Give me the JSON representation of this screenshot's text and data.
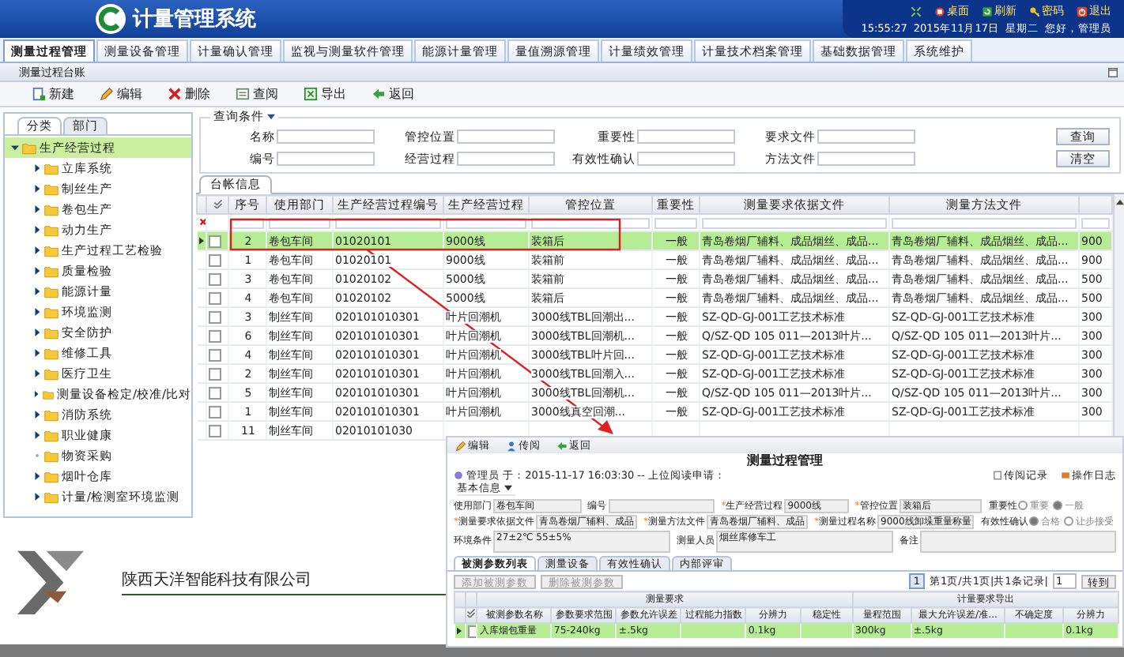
{
  "header": {
    "title": "计量管理系统",
    "links": [
      {
        "label": "桌面",
        "kind": "desktop"
      },
      {
        "label": "刷新",
        "kind": "refresh"
      },
      {
        "label": "密码",
        "kind": "key"
      },
      {
        "label": "退出",
        "kind": "exit"
      }
    ],
    "status": [
      "15:55:27",
      "2015年11月17日",
      "星期二",
      "您好，管理员"
    ]
  },
  "menu": [
    {
      "label": "测量过程管理",
      "selected": true
    },
    {
      "label": "测量设备管理",
      "selected": false
    },
    {
      "label": "计量确认管理",
      "selected": false
    },
    {
      "label": "监视与测量软件管理",
      "selected": false
    },
    {
      "label": "能源计量管理",
      "selected": false
    },
    {
      "label": "量值溯源管理",
      "selected": false
    },
    {
      "label": "计量绩效管理",
      "selected": false
    },
    {
      "label": "计量技术档案管理",
      "selected": false
    },
    {
      "label": "基础数据管理",
      "selected": false
    },
    {
      "label": "系统维护",
      "selected": false
    }
  ],
  "panel": {
    "title": "测量过程台账"
  },
  "toolbar": [
    {
      "label": "新建",
      "kind": "new"
    },
    {
      "label": "编辑",
      "kind": "edit"
    },
    {
      "label": "删除",
      "kind": "delete"
    },
    {
      "label": "查阅",
      "kind": "view"
    },
    {
      "label": "导出",
      "kind": "export"
    },
    {
      "label": "返回",
      "kind": "back"
    }
  ],
  "sidebar": {
    "tabs": [
      {
        "label": "分类",
        "selected": true
      },
      {
        "label": "部门",
        "selected": false
      }
    ],
    "tree": {
      "label": "生产经营过程",
      "has_children": true,
      "expanded": true,
      "selected": true,
      "children": [
        {
          "label": "立库系统",
          "has_children": true,
          "expanded": false,
          "selected": false
        },
        {
          "label": "制丝生产",
          "has_children": true,
          "expanded": false,
          "selected": false
        },
        {
          "label": "卷包生产",
          "has_children": true,
          "expanded": false,
          "selected": false
        },
        {
          "label": "动力生产",
          "has_children": true,
          "expanded": false,
          "selected": false
        },
        {
          "label": "生产过程工艺检验",
          "has_children": true,
          "expanded": false,
          "selected": false
        },
        {
          "label": "质量检验",
          "has_children": true,
          "expanded": false,
          "selected": false
        },
        {
          "label": "能源计量",
          "has_children": true,
          "expanded": false,
          "selected": false
        },
        {
          "label": "环境监测",
          "has_children": true,
          "expanded": false,
          "selected": false
        },
        {
          "label": "安全防护",
          "has_children": true,
          "expanded": false,
          "selected": false
        },
        {
          "label": "维修工具",
          "has_children": true,
          "expanded": false,
          "selected": false
        },
        {
          "label": "医疗卫生",
          "has_children": true,
          "expanded": false,
          "selected": false
        },
        {
          "label": "测量设备检定/校准/比对",
          "has_children": true,
          "expanded": false,
          "selected": false
        },
        {
          "label": "消防系统",
          "has_children": true,
          "expanded": false,
          "selected": false
        },
        {
          "label": "职业健康",
          "has_children": true,
          "expanded": false,
          "selected": false
        },
        {
          "label": "物资采购",
          "has_children": false,
          "selected": false
        },
        {
          "label": "烟叶仓库",
          "has_children": true,
          "expanded": false,
          "selected": false
        },
        {
          "label": "计量/检测室环境监测",
          "has_children": true,
          "expanded": false,
          "selected": false
        }
      ]
    }
  },
  "query": {
    "legend": "查询条件",
    "fields": [
      {
        "label": "名称"
      },
      {
        "label": "管控位置"
      },
      {
        "label": "重要性"
      },
      {
        "label": "要求文件"
      },
      {
        "label": "编号"
      },
      {
        "label": "经营过程"
      },
      {
        "label": "有效性确认"
      },
      {
        "label": "方法文件"
      }
    ],
    "buttons": [
      "查询",
      "清空"
    ]
  },
  "table": {
    "tab": "台帐信息",
    "columns": [
      "序号",
      "使用部门",
      "生产经营过程编号",
      "生产经营过程",
      "管控位置",
      "重要性",
      "测量要求依据文件",
      "测量方法文件"
    ],
    "rows": [
      {
        "selected": true,
        "checked": false,
        "cells": [
          "2",
          "卷包车间",
          "01020101",
          "9000线",
          "装箱后",
          "一般",
          "青岛卷烟厂辅料、成品烟丝、成品...",
          "青岛卷烟厂辅料、成品烟丝、成品...",
          "900"
        ]
      },
      {
        "selected": false,
        "checked": false,
        "cells": [
          "1",
          "卷包车间",
          "01020101",
          "9000线",
          "装箱前",
          "一般",
          "青岛卷烟厂辅料、成品烟丝、成品...",
          "青岛卷烟厂辅料、成品烟丝、成品...",
          "900"
        ]
      },
      {
        "selected": false,
        "checked": false,
        "cells": [
          "3",
          "卷包车间",
          "01020102",
          "5000线",
          "装箱前",
          "一般",
          "青岛卷烟厂辅料、成品烟丝、成品...",
          "青岛卷烟厂辅料、成品烟丝、成品...",
          "500"
        ]
      },
      {
        "selected": false,
        "checked": false,
        "cells": [
          "4",
          "卷包车间",
          "01020102",
          "5000线",
          "装箱后",
          "一般",
          "青岛卷烟厂辅料、成品烟丝、成品...",
          "青岛卷烟厂辅料、成品烟丝、成品...",
          "500"
        ]
      },
      {
        "selected": false,
        "checked": false,
        "cells": [
          "3",
          "制丝车间",
          "020101010301",
          "叶片回潮机",
          "3000线TBL回潮出...",
          "一般",
          "SZ-QD-GJ-001工艺技术标准",
          "SZ-QD-GJ-001工艺技术标准",
          "300"
        ]
      },
      {
        "selected": false,
        "checked": false,
        "cells": [
          "6",
          "制丝车间",
          "020101010301",
          "叶片回潮机",
          "3000线TBL回潮机...",
          "一般",
          "Q/SZ-QD 105 011—2013叶片...",
          "Q/SZ-QD 105 011—2013叶片...",
          "300"
        ]
      },
      {
        "selected": false,
        "checked": false,
        "cells": [
          "4",
          "制丝车间",
          "020101010301",
          "叶片回潮机",
          "3000线TBL叶片回...",
          "一般",
          "SZ-QD-GJ-001工艺技术标准",
          "SZ-QD-GJ-001工艺技术标准",
          "300"
        ]
      },
      {
        "selected": false,
        "checked": false,
        "cells": [
          "2",
          "制丝车间",
          "020101010301",
          "叶片回潮机",
          "3000线TBL回潮入...",
          "一般",
          "SZ-QD-GJ-001工艺技术标准",
          "SZ-QD-GJ-001工艺技术标准",
          "300"
        ]
      },
      {
        "selected": false,
        "checked": false,
        "cells": [
          "5",
          "制丝车间",
          "020101010301",
          "叶片回潮机",
          "3000线TBL回潮机...",
          "一般",
          "Q/SZ-QD 105 011—2013叶片...",
          "Q/SZ-QD 105 011—2013叶片...",
          "300"
        ]
      },
      {
        "selected": false,
        "checked": false,
        "cells": [
          "1",
          "制丝车间",
          "020101010301",
          "叶片回潮机",
          "3000线真空回潮...",
          "一般",
          "SZ-QD-GJ-001工艺技术标准",
          "SZ-QD-GJ-001工艺技术标准",
          "300"
        ]
      },
      {
        "selected": false,
        "checked": false,
        "cells": [
          "11",
          "制丝车间",
          "02010101030"
        ]
      }
    ]
  },
  "detail_window": {
    "toolbar": [
      {
        "label": "编辑",
        "kind": "edit"
      },
      {
        "label": "传阅",
        "kind": "share"
      },
      {
        "label": "返回",
        "kind": "back"
      }
    ],
    "title": "测量过程管理",
    "meta": "管理员 于：2015-11-17 16:03:30 -- 上位阅读申请：",
    "links": [
      {
        "label": "传阅记录",
        "kind": "doc"
      },
      {
        "label": "操作日志",
        "kind": "log"
      }
    ],
    "section": "基本信息",
    "field_rows": [
      [
        {
          "label": "使用部门",
          "value": "卷包车间",
          "kind": "text"
        },
        {
          "label": "编号",
          "kind": "text"
        },
        {
          "label": "生产经营过程",
          "value": "9000线",
          "kind": "text",
          "required_mark": "*"
        },
        {
          "label": "管控位置",
          "value": "装箱后",
          "kind": "text",
          "required_mark": "*"
        },
        {
          "label": "重要性",
          "kind": "radio",
          "options": [
            {
              "label": "重要",
              "selected": false
            },
            {
              "label": "一般",
              "selected": true
            }
          ]
        }
      ],
      [
        {
          "label": "测量要求依据文件",
          "value": "青岛卷烟厂辅料、成品",
          "kind": "text",
          "required_mark": "*"
        },
        {
          "label": "测量方法文件",
          "value": "青岛卷烟厂辅料、成品",
          "kind": "text",
          "required_mark": "*"
        },
        {
          "label": "测量过程名称",
          "value": "9000线卸垛重量称量",
          "kind": "text",
          "required_mark": "*"
        },
        {
          "label": "有效性确认",
          "kind": "radio",
          "options": [
            {
              "label": "合格",
              "selected": true
            },
            {
              "label": "让步接受",
              "selected": false
            }
          ]
        }
      ],
      [
        {
          "label": "环境条件",
          "value": "27±2℃ 55±5%",
          "kind": "area"
        },
        {
          "label": "测量人员",
          "value": "烟丝库修车工",
          "kind": "area"
        },
        {
          "label": "备注",
          "kind": "area"
        }
      ]
    ],
    "tabs": [
      {
        "label": "被测参数列表",
        "selected": true
      },
      {
        "label": "测量设备",
        "selected": false
      },
      {
        "label": "有效性确认",
        "selected": false
      },
      {
        "label": "内部评审",
        "selected": false
      }
    ],
    "buttons": [
      {
        "label": "添加被测参数",
        "disabled": true
      },
      {
        "label": "删除被测参数",
        "disabled": true
      }
    ],
    "pager": {
      "page": "1",
      "info": "第1页/共1页|共1条记录|",
      "input": "1",
      "go": "转到"
    },
    "groups": [
      {
        "label": "测量要求"
      },
      {
        "label": "计量要求导出"
      }
    ],
    "columns": [
      "被测参数名称",
      "参数要求范围",
      "参数允许误差",
      "过程能力指数",
      "分辨力",
      "稳定性",
      "量程范围",
      "最大允许误差/准...",
      "不确定度",
      "分辨力"
    ],
    "rows": [
      {
        "selected": true,
        "cells": [
          "入库烟包重量",
          "75-240kg",
          "±.5kg",
          "",
          "0.1kg",
          "",
          "300kg",
          "±.5kg",
          "",
          "0.1kg"
        ]
      }
    ]
  },
  "footer": {
    "company": "陕西天洋智能科技有限公司"
  }
}
